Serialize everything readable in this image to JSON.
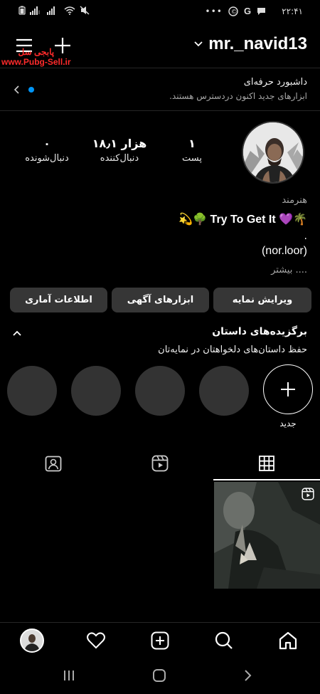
{
  "status_bar": {
    "time": "۲۲:۴۱",
    "dots": "•••"
  },
  "header": {
    "username": "mr._navid13"
  },
  "watermark": {
    "line1": "پابجی سل",
    "line2": "www.Pubg-Sell.ir"
  },
  "dashboard": {
    "title": "داشبورد حرفه‌ای",
    "subtitle": "ابزارهای جدید اکنون دردسترس هستند."
  },
  "stats": [
    {
      "value": "۱",
      "label": "پست"
    },
    {
      "value": "۱۸٫۱ هزار",
      "label": "دنبال‌کننده"
    },
    {
      "value": "۰",
      "label": "دنبال‌شونده"
    }
  ],
  "bio": {
    "category": "هنرمند",
    "line1": "Try To Get It 💜🌴",
    "line1_prefix": "💫🌳 ",
    "dot": ".",
    "handle": "(nor.loor)",
    "more": ".... بیشتر"
  },
  "buttons": {
    "edit_profile": "ویرایش نمایه",
    "ad_tools": "ابزارهای آگهی",
    "insights": "اطلاعات آماری"
  },
  "highlights": {
    "title": "برگزیده‌های داستان",
    "subtitle": "حفظ داستان‌های دلخواهتان در نمایه‌تان",
    "new_label": "جدید"
  },
  "colors": {
    "accent_dot": "#0095f6",
    "background": "#000000",
    "button": "#363636",
    "watermark": "#ff2b2b"
  }
}
